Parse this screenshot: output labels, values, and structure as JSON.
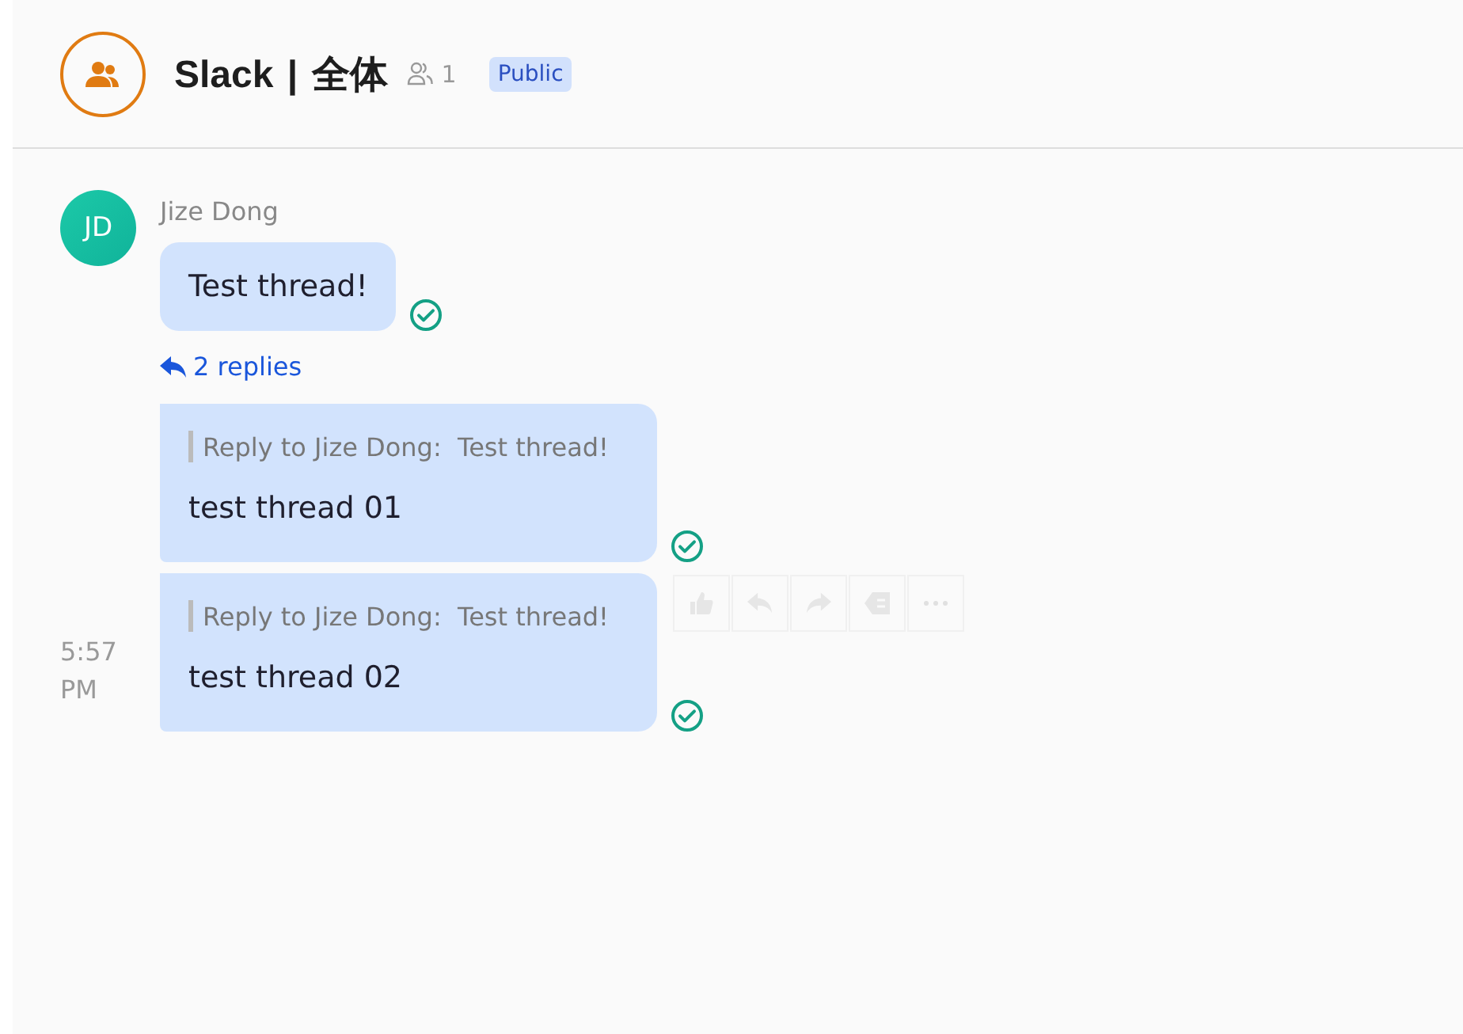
{
  "channel": {
    "title": "Slack | 全体",
    "member_count": "1",
    "badge": "Public"
  },
  "message": {
    "initials": "JD",
    "author": "Jize Dong",
    "text": "Test thread!",
    "delivered": true,
    "replies_link": "2 replies"
  },
  "replies": [
    {
      "quote_label": "Reply to Jize Dong:",
      "quote_text": "Test thread!",
      "text": "test thread 01",
      "delivered": true,
      "hovered": false
    },
    {
      "quote_label": "Reply to Jize Dong:",
      "quote_text": "Test thread!",
      "text": "test thread 02",
      "delivered": true,
      "hovered": true,
      "time": "5:57 PM"
    }
  ]
}
